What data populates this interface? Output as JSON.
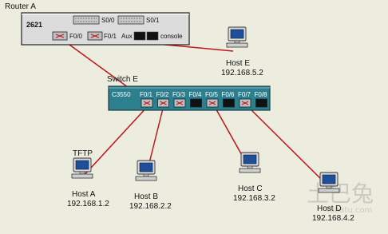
{
  "router": {
    "title": "Router A",
    "model": "2621",
    "serial_ports": [
      "S0/0",
      "S0/1"
    ],
    "eth_ports": [
      "F0/0",
      "F0/1"
    ],
    "aux_label": "Aux",
    "console_label": "console"
  },
  "switch": {
    "title": "Switch E",
    "model": "C3550",
    "ports": [
      "F0/1",
      "F0/2",
      "F0/3",
      "F0/4",
      "F0/5",
      "F0/6",
      "F0/7",
      "F0/8"
    ]
  },
  "hosts": [
    {
      "name": "Host E",
      "ip": "192.168.5.2",
      "role": ""
    },
    {
      "name": "Host A",
      "ip": "192.168.1.2",
      "role": "TFTP"
    },
    {
      "name": "Host B",
      "ip": "192.168.2.2",
      "role": ""
    },
    {
      "name": "Host C",
      "ip": "192.168.3.2",
      "role": ""
    },
    {
      "name": "Host D",
      "ip": "192.168.4.2",
      "role": ""
    }
  ],
  "watermark": {
    "glyphs": "土巴兔",
    "text": "Tubatu.com"
  },
  "colors": {
    "background": "#ededdf",
    "cable": "#c0141c",
    "switch_body": "#2e7f8e",
    "router_body": "#dcdcdc"
  }
}
